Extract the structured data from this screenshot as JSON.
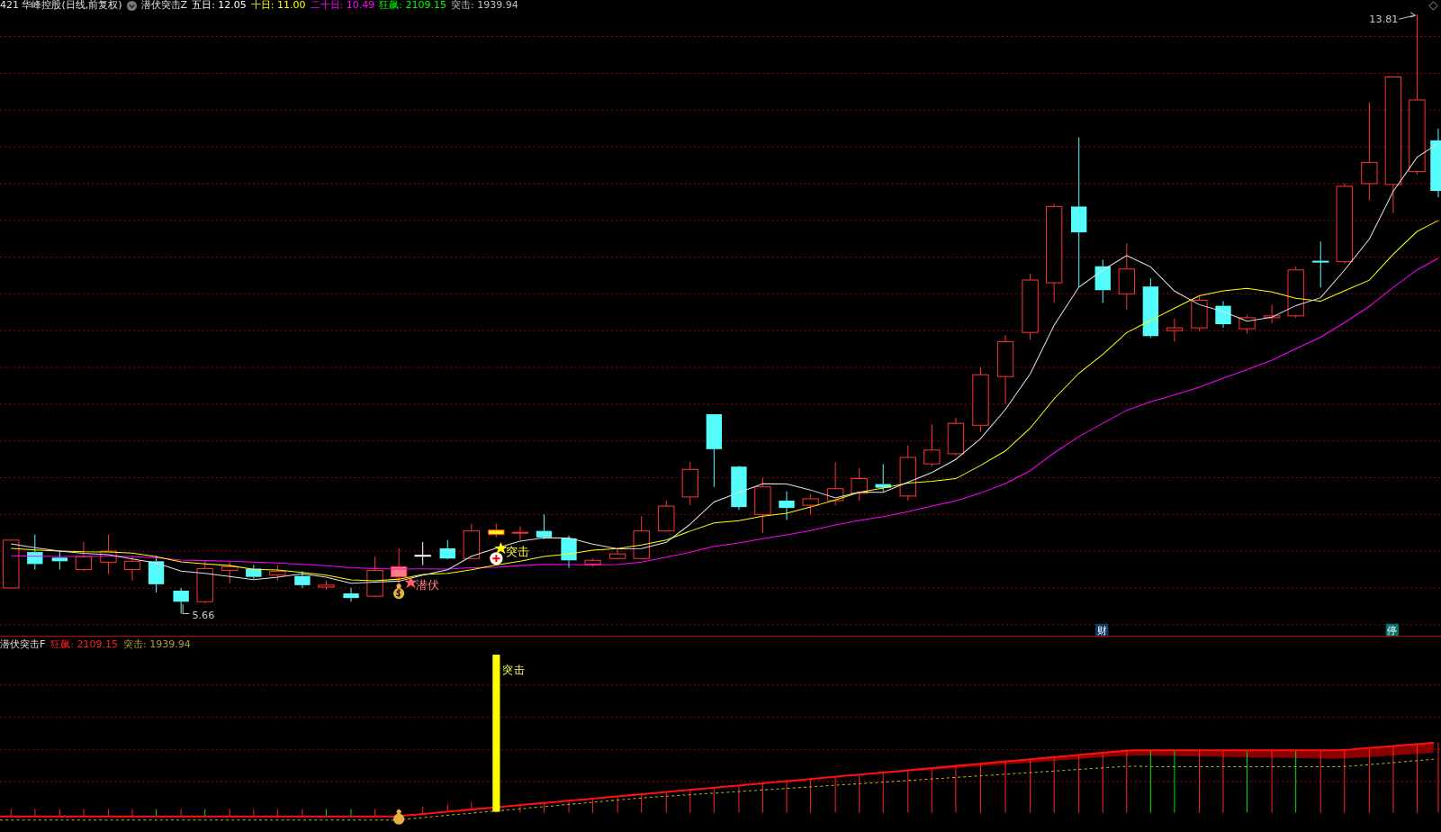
{
  "header": {
    "title": "421 华峰控股(日线,前复权)",
    "indicator": "潜伏突击Z",
    "legend": [
      {
        "label": "五日: 12.05",
        "color": "#ffffff"
      },
      {
        "label": "十日: 11.00",
        "color": "#ffff00"
      },
      {
        "label": "二十日: 10.49",
        "color": "#ff00ff"
      },
      {
        "label": "狂飙: 2109.15",
        "color": "#00ff00"
      },
      {
        "label": "突击: 1939.94",
        "color": "#c0c0c0"
      }
    ]
  },
  "main_chart": {
    "high_label": "13.81",
    "low_label": "5.66",
    "signals": [
      {
        "kind": "latent",
        "label": "潜伏"
      },
      {
        "kind": "strike",
        "label": "突击"
      }
    ],
    "badges": [
      {
        "label": "财",
        "color": "#123a6a"
      },
      {
        "label": "停",
        "color": "#0a6f6f"
      }
    ]
  },
  "sub_chart": {
    "title": "潜伏突击F",
    "legend": [
      {
        "label": "狂飙: 2109.15",
        "color": "#ff2020"
      },
      {
        "label": "突击: 1939.94",
        "color": "#b0a030"
      }
    ],
    "bar_label": "突击"
  }
}
